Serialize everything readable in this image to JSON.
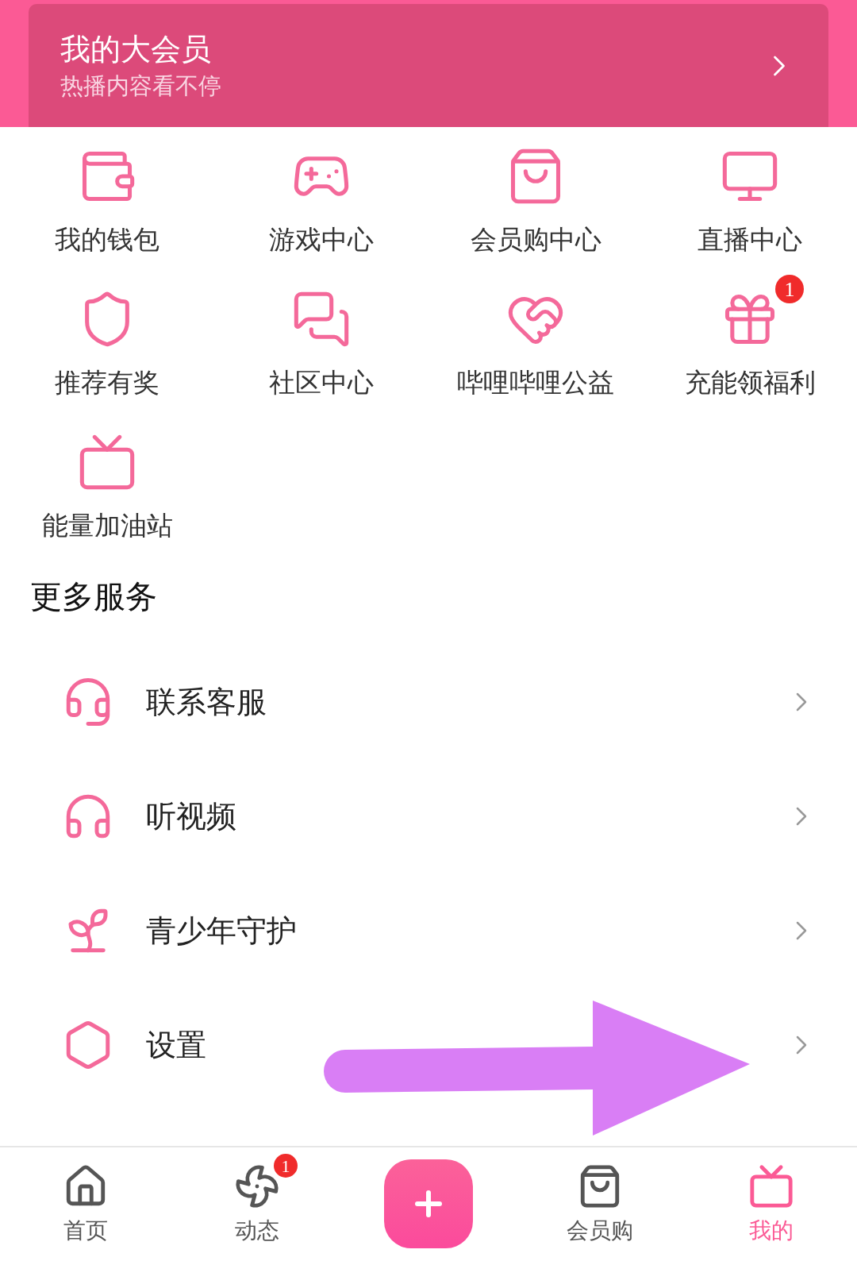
{
  "member_banner": {
    "title": "我的大会员",
    "subtitle": "热播内容看不停"
  },
  "services": [
    {
      "label": "我的钱包"
    },
    {
      "label": "游戏中心"
    },
    {
      "label": "会员购中心"
    },
    {
      "label": "直播中心"
    },
    {
      "label": "推荐有奖"
    },
    {
      "label": "社区中心"
    },
    {
      "label": "哔哩哔哩公益"
    },
    {
      "label": "充能领福利",
      "badge": "1"
    },
    {
      "label": "能量加油站"
    }
  ],
  "more_services": {
    "title": "更多服务",
    "items": [
      {
        "label": "联系客服"
      },
      {
        "label": "听视频"
      },
      {
        "label": "青少年守护"
      },
      {
        "label": "设置"
      }
    ]
  },
  "bottom_nav": [
    {
      "kind": "tab",
      "label": "首页",
      "selected": false
    },
    {
      "kind": "tab",
      "label": "动态",
      "selected": false,
      "badge": "1"
    },
    {
      "kind": "post"
    },
    {
      "kind": "tab",
      "label": "会员购",
      "selected": false
    },
    {
      "kind": "tab",
      "label": "我的",
      "selected": true
    }
  ]
}
